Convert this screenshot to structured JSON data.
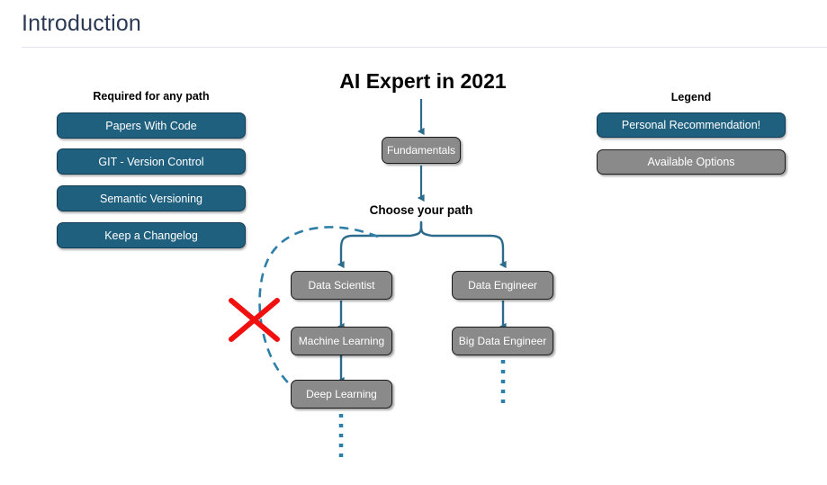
{
  "header": {
    "title": "Introduction"
  },
  "left_panel": {
    "caption": "Required for any path",
    "items": [
      {
        "label": "Papers With Code"
      },
      {
        "label": "GIT - Version Control"
      },
      {
        "label": "Semantic Versioning"
      },
      {
        "label": "Keep a Changelog"
      }
    ]
  },
  "legend": {
    "caption": "Legend",
    "items": [
      {
        "label": "Personal Recommendation!",
        "style": "teal"
      },
      {
        "label": "Available Options",
        "style": "gray"
      }
    ]
  },
  "flow": {
    "title": "AI Expert in 2021",
    "choose_label": "Choose your path",
    "nodes": [
      {
        "label": "Fundamentals"
      },
      {
        "label": "Data Scientist"
      },
      {
        "label": "Machine Learning"
      },
      {
        "label": "Deep Learning"
      },
      {
        "label": "Data Engineer"
      },
      {
        "label": "Big Data Engineer"
      }
    ]
  },
  "colors": {
    "teal": "#20607f",
    "gray": "#8a8a8a",
    "arrow": "#2d6b8c",
    "title": "#2b3a54",
    "cross": "#f01010"
  }
}
